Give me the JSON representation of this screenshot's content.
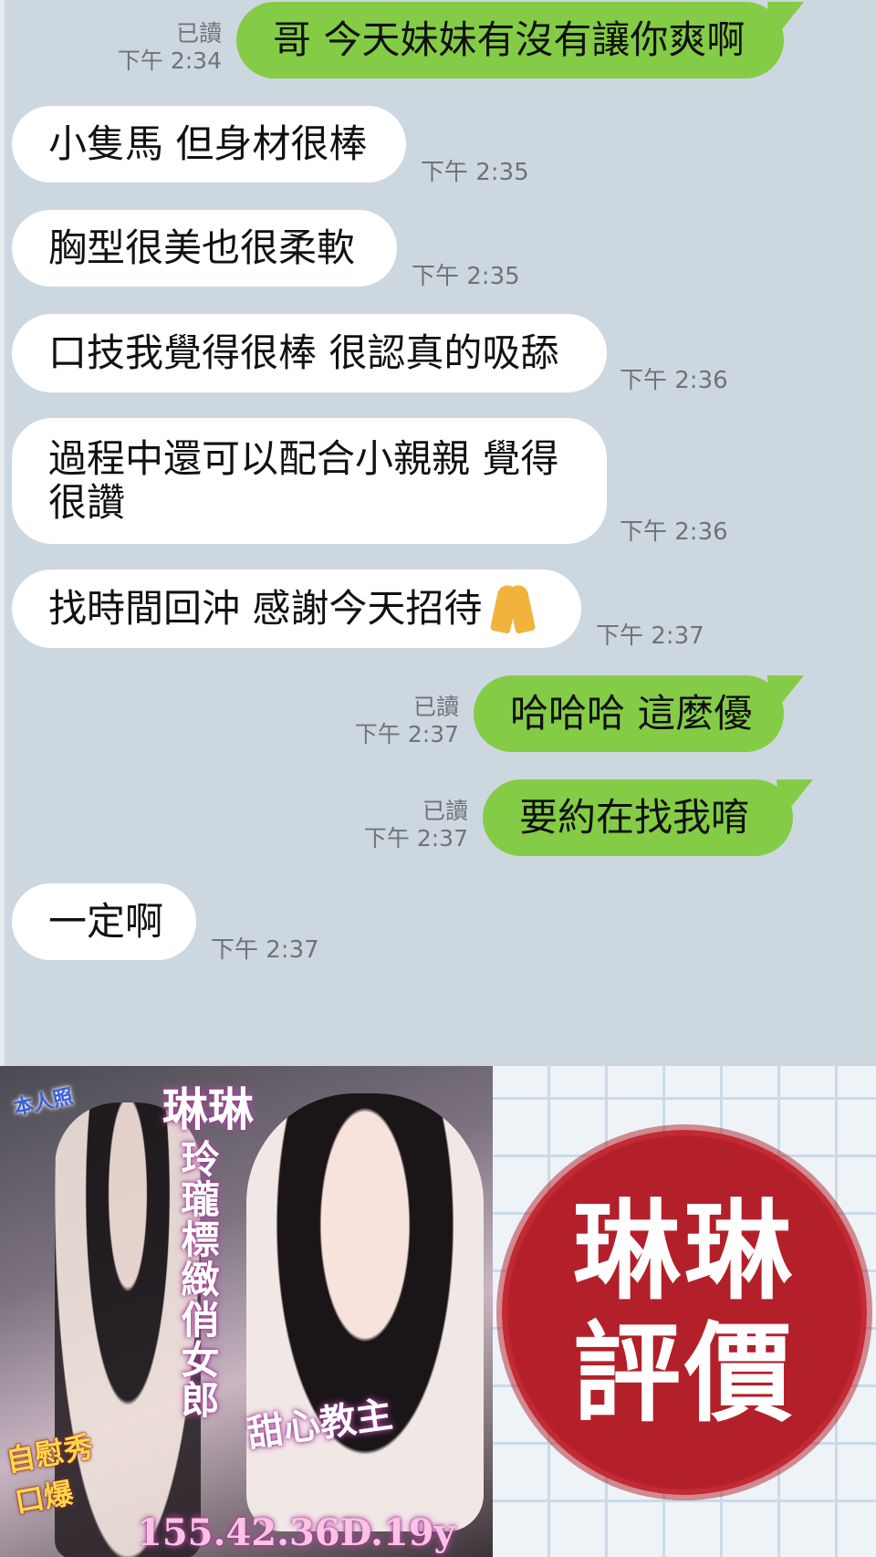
{
  "messages": [
    {
      "dir": "out",
      "text": "哥 今天妹妹有沒有讓你爽啊",
      "read": "已讀",
      "time": "下午 2:34"
    },
    {
      "dir": "in",
      "text": "小隻馬 但身材很棒",
      "time": "下午 2:35"
    },
    {
      "dir": "in",
      "text": "胸型很美也很柔軟",
      "time": "下午 2:35"
    },
    {
      "dir": "in",
      "text": "口技我覺得很棒 很認真的吸舔",
      "time": "下午 2:36"
    },
    {
      "dir": "in",
      "text": "過程中還可以配合小親親 覺得很讚",
      "time": "下午 2:36"
    },
    {
      "dir": "in",
      "text": "找時間回沖 感謝今天招待",
      "emoji": "folded-hands",
      "time": "下午 2:37"
    },
    {
      "dir": "out",
      "text": "哈哈哈 這麼優",
      "read": "已讀",
      "time": "下午 2:37"
    },
    {
      "dir": "out",
      "text": "要約在找我唷",
      "read": "已讀",
      "time": "下午 2:37"
    },
    {
      "dir": "in",
      "text": "一定啊",
      "time": "下午 2:37"
    }
  ],
  "ad": {
    "badge": "本人照",
    "name": "琳琳",
    "slogan": "玲瓏標緻俏女郎",
    "nickname": "甜心教主",
    "services": [
      "自慰秀",
      "口爆"
    ],
    "stats": "155.42.36D.19y"
  },
  "stamp": {
    "line1": "琳琳",
    "line2": "評價"
  },
  "colors": {
    "chat_bg": "#cdd7e0",
    "outgoing": "#84cc46",
    "incoming": "#ffffff",
    "stamp": "#b3202a"
  }
}
